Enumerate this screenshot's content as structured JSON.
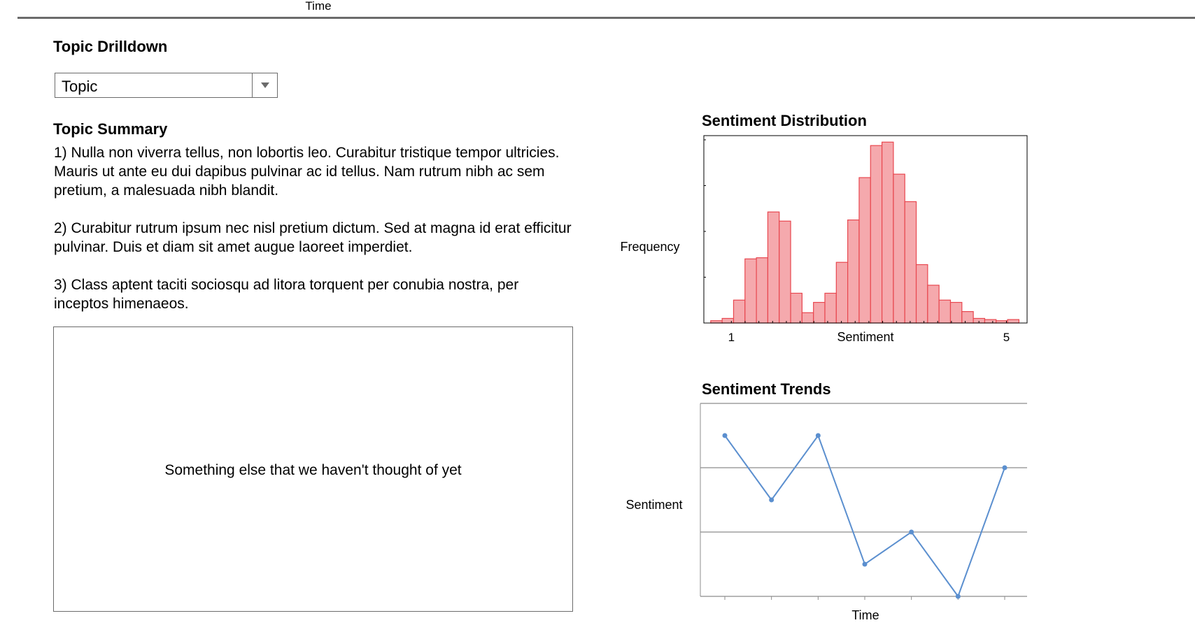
{
  "top_chart_fragment": {
    "xlabel": "Time"
  },
  "drilldown": {
    "title": "Topic Drilldown",
    "dropdown_value": "Topic"
  },
  "summary": {
    "title": "Topic Summary",
    "paragraphs": [
      "1) Nulla non viverra tellus, non lobortis leo. Curabitur tristique tempor ultricies. Mauris ut ante eu dui dapibus pulvinar ac id tellus. Nam rutrum nibh ac sem pretium, a malesuada nibh blandit.",
      "2) Curabitur rutrum ipsum nec nisl pretium dictum. Sed at magna id erat efficitur pulvinar. Duis et diam sit amet augue laoreet imperdiet.",
      "3) Class aptent taciti sociosqu ad litora torquent per conubia nostra, per inceptos himenaeos."
    ]
  },
  "placeholder": {
    "text": "Something else that we haven't thought of yet"
  },
  "colors": {
    "bar_fill": "#f5a9ad",
    "bar_stroke": "#e8474f",
    "line": "#5b8fcf",
    "grid": "#8c8c8c",
    "frame": "#6b6b6b"
  },
  "chart_data": [
    {
      "type": "bar",
      "title": "Sentiment Distribution",
      "xlabel": "Sentiment",
      "ylabel": "Frequency",
      "xticklabels": [
        "1",
        "5"
      ],
      "xlim": [
        0.6,
        5.3
      ],
      "bin_width": 0.166,
      "bin_starts": [
        0.7,
        0.866,
        1.032,
        1.198,
        1.364,
        1.53,
        1.696,
        1.862,
        2.028,
        2.194,
        2.36,
        2.526,
        2.692,
        2.858,
        3.024,
        3.19,
        3.356,
        3.522,
        3.688,
        3.854,
        4.02,
        4.186,
        4.352,
        4.518,
        4.684,
        4.85,
        5.016
      ],
      "values": [
        2,
        4,
        20,
        56,
        57,
        97,
        89,
        26,
        9,
        18,
        26,
        53,
        90,
        127,
        155,
        158,
        130,
        106,
        51,
        33,
        20,
        18,
        10,
        4,
        3,
        2,
        3
      ],
      "ylim": [
        0,
        160
      ],
      "grid": false
    },
    {
      "type": "line",
      "title": "Sentiment Trends",
      "xlabel": "Time",
      "ylabel": "Sentiment",
      "x": [
        1,
        2,
        3,
        4,
        5,
        6,
        7
      ],
      "y": [
        2.5,
        1.5,
        2.5,
        0.5,
        1.0,
        0.0,
        2.0
      ],
      "ylim": [
        0,
        3
      ],
      "grid": true
    }
  ]
}
